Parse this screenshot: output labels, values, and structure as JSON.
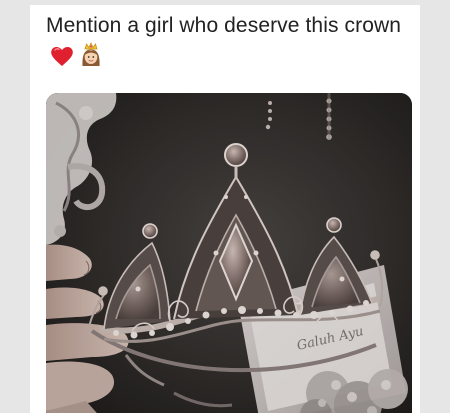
{
  "post": {
    "text": "Mention a girl who deserve this crown",
    "emojis": [
      "red-heart-icon",
      "princess-icon"
    ]
  },
  "media": {
    "alt": "",
    "watermark_text": "Galuh Ayu"
  },
  "colors": {
    "page_background": "#e6e6e6",
    "card_background": "#ffffff",
    "text": "#222222",
    "heart": "#e0202e"
  }
}
